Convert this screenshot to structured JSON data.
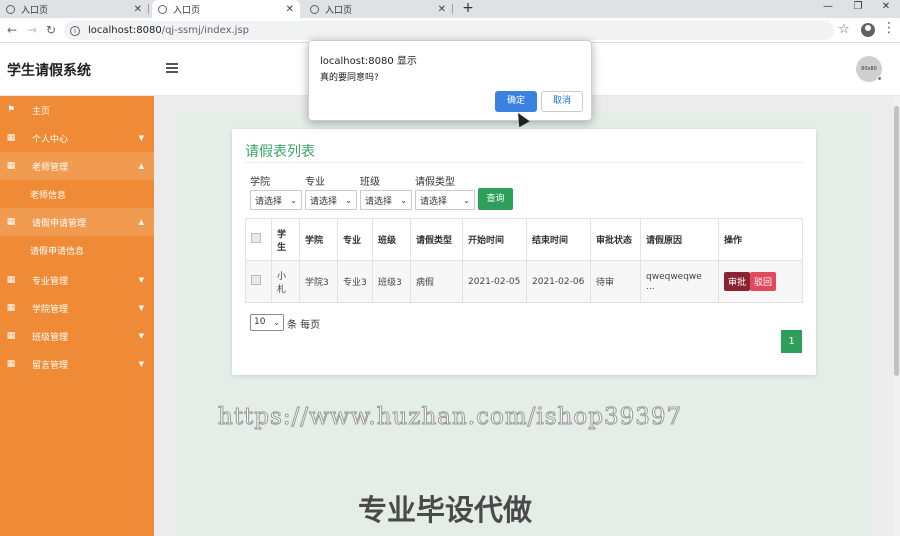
{
  "browser": {
    "tabs": [
      {
        "title": "入口页"
      },
      {
        "title": "入口页"
      },
      {
        "title": "入口页"
      }
    ],
    "url_host": "localhost:8080",
    "url_path": "/qj-ssmj/index.jsp"
  },
  "header": {
    "brand": "学生请假系统",
    "avatar_text": "80x80"
  },
  "sidebar": {
    "items": [
      {
        "label": "主页",
        "icon": "flag-icon"
      },
      {
        "label": "个人中心"
      },
      {
        "label": "老师管理"
      },
      {
        "label": "老师信息"
      },
      {
        "label": "请假申请管理"
      },
      {
        "label": "请假申请信息"
      },
      {
        "label": "专业管理"
      },
      {
        "label": "学院管理"
      },
      {
        "label": "班级管理"
      },
      {
        "label": "留言管理"
      }
    ]
  },
  "card": {
    "title": "请假表列表",
    "filters": [
      {
        "label": "学院",
        "value": "请选择"
      },
      {
        "label": "专业",
        "value": "请选择"
      },
      {
        "label": "班级",
        "value": "请选择"
      },
      {
        "label": "请假类型",
        "value": "请选择"
      }
    ],
    "query_button": "查询",
    "table": {
      "headers": [
        "学生",
        "学院",
        "专业",
        "班级",
        "请假类型",
        "开始时间",
        "结束时间",
        "审批状态",
        "请假原因",
        "操作"
      ],
      "rows": [
        {
          "student": "小札",
          "college": "学院3",
          "major": "专业3",
          "class": "班级3",
          "leave_type": "病假",
          "start": "2021-02-05",
          "end": "2021-02-06",
          "status": "待审",
          "reason": "qweqweqwe ...",
          "approve": "审批",
          "reject": "驳回"
        }
      ]
    },
    "page_size": "10",
    "page_size_text": "条 每页",
    "current_page": "1"
  },
  "watermark": "https://www.huzhan.com/ishop39397",
  "overlay_text": "专业毕设代做",
  "dialog": {
    "title": "localhost:8080 显示",
    "message": "真的要同意吗?",
    "ok": "确定",
    "cancel": "取消"
  }
}
